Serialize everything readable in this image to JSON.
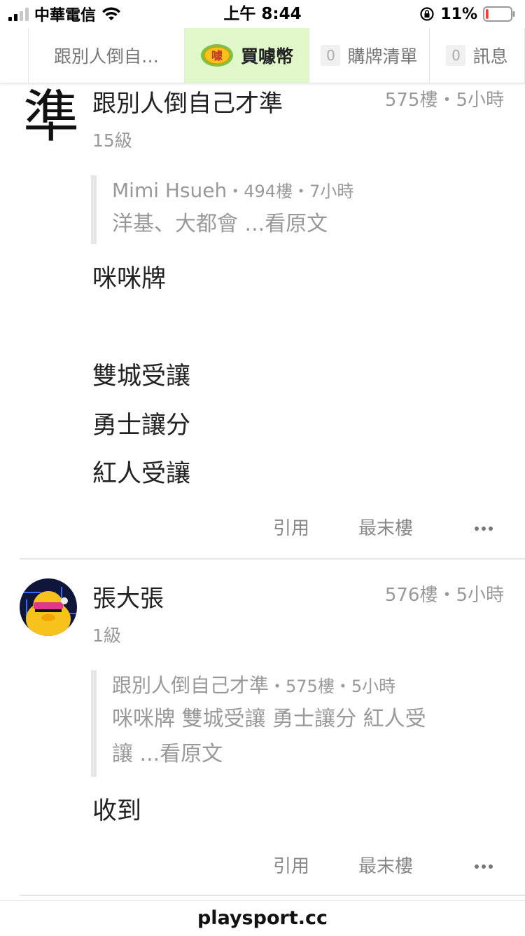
{
  "status_bar": {
    "carrier": "中華電信",
    "time": "上午 8:44",
    "battery_percent": "11%",
    "battery_level": 0.11,
    "battery_color": "#ff3b30"
  },
  "nav": {
    "topic_tab": "跟別人倒自…",
    "coins_tab": "買噱幣",
    "coin_logo_text": "噱",
    "cart_count": "0",
    "cart_tab": "購牌清單",
    "msg_count": "0",
    "msg_tab": "訊息"
  },
  "posts": [
    {
      "avatar_char": "準",
      "author": "跟別人倒自己才準",
      "meta": "575樓・5小時",
      "level": "15級",
      "quote": {
        "author": "Mimi Hsueh",
        "meta": "・494樓・7小時",
        "lines": [
          "洋基、大都會 ...看原文"
        ]
      },
      "content": [
        "咪咪牌",
        "雙城受讓",
        "勇士讓分",
        "紅人受讓"
      ],
      "actions": {
        "quote": "引用",
        "last": "最末樓"
      }
    },
    {
      "author": "張大張",
      "meta": "576樓・5小時",
      "level": "1級",
      "quote": {
        "author": "跟別人倒自己才準",
        "meta": "・575樓・5小時",
        "lines": [
          "咪咪牌  雙城受讓 勇士讓分 紅人受",
          "讓 ...看原文"
        ]
      },
      "content": [
        "收到"
      ],
      "actions": {
        "quote": "引用",
        "last": "最末樓"
      }
    }
  ],
  "url": "playsport.cc",
  "colors": {
    "coin_tab_bg": "#dff7c9",
    "text_primary": "#222222",
    "text_muted": "#999999"
  }
}
